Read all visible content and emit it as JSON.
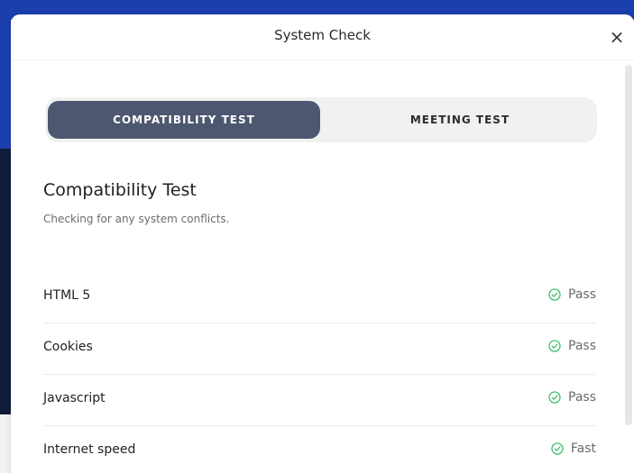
{
  "modal": {
    "title": "System Check",
    "close_label": "×"
  },
  "tabs": [
    {
      "label": "COMPATIBILITY TEST",
      "active": true
    },
    {
      "label": "MEETING TEST",
      "active": false
    }
  ],
  "section": {
    "title": "Compatibility Test",
    "subtitle": "Checking for any system conflicts."
  },
  "checks": [
    {
      "name": "HTML 5",
      "status": "Pass",
      "icon": "check-circle-icon"
    },
    {
      "name": "Cookies",
      "status": "Pass",
      "icon": "check-circle-icon"
    },
    {
      "name": "Javascript",
      "status": "Pass",
      "icon": "check-circle-icon"
    },
    {
      "name": "Internet speed",
      "status": "Fast",
      "icon": "check-circle-icon"
    }
  ],
  "colors": {
    "active_tab_bg": "#4d5770",
    "status_icon": "#3fbf6f",
    "background_brand": "#1c3fae"
  }
}
